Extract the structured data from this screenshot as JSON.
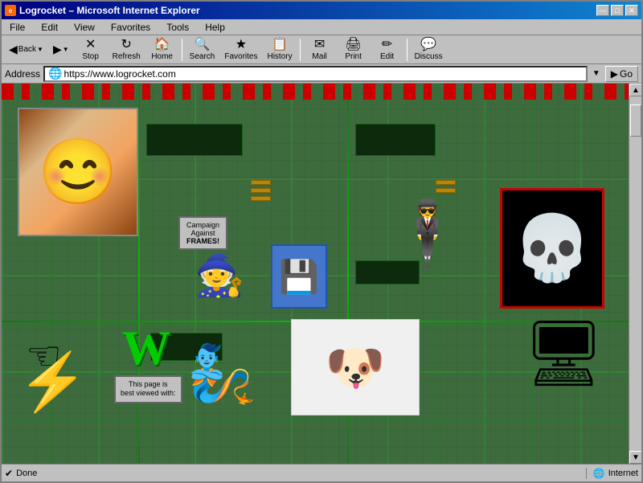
{
  "window": {
    "title": "Logrocket – Microsoft Internet Explorer",
    "icon": "🌐"
  },
  "title_buttons": {
    "minimize": "—",
    "maximize": "□",
    "close": "✕"
  },
  "menu": {
    "items": [
      "File",
      "Edit",
      "View",
      "Favorites",
      "Tools",
      "Help"
    ]
  },
  "toolbar": {
    "back_label": "Back",
    "forward_label": "Forward",
    "stop_label": "Stop",
    "refresh_label": "Refresh",
    "home_label": "Home",
    "search_label": "Search",
    "favorites_label": "Favorites",
    "history_label": "History",
    "mail_label": "Mail",
    "print_label": "Print",
    "edit_label": "Edit",
    "discuss_label": "Discuss"
  },
  "address_bar": {
    "label": "Address",
    "url": "https://www.logrocket.com",
    "go_label": "Go"
  },
  "status_bar": {
    "left_text": "Done",
    "zone_text": "Internet"
  },
  "page": {
    "campaign_badge_line1": "Campaign",
    "campaign_badge_line2": "Against",
    "campaign_badge_line3": "FRAMES!",
    "best_viewed_line1": "This page is",
    "best_viewed_line2": "best viewed with:"
  }
}
